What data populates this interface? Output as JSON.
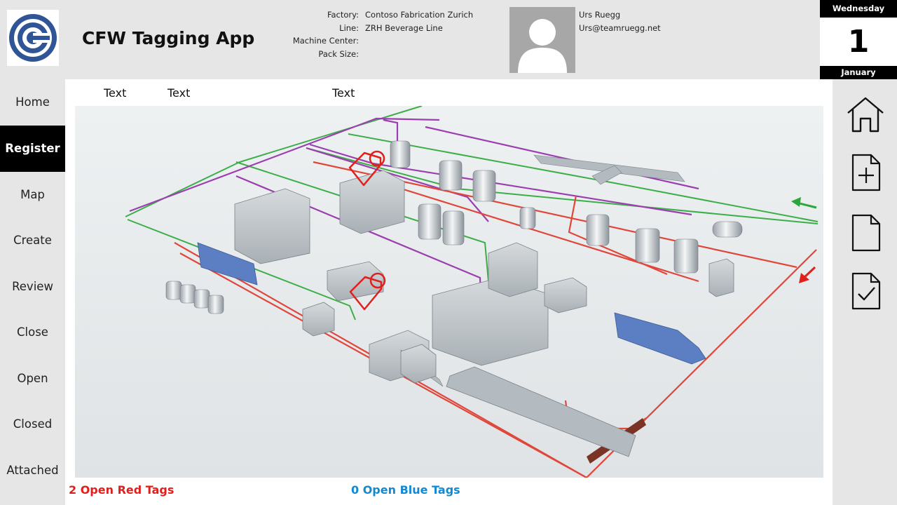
{
  "app": {
    "title": "CFW Tagging App"
  },
  "info": {
    "labels": [
      "Factory:",
      "Line:",
      "Machine Center:",
      "Pack Size:"
    ],
    "values": [
      "Contoso Fabrication Zurich",
      "ZRH Beverage Line",
      "",
      ""
    ]
  },
  "user": {
    "name": "Urs Ruegg",
    "email": "Urs@teamruegg.net"
  },
  "calendar": {
    "weekday": "Wednesday",
    "day": "1",
    "month": "January"
  },
  "nav": {
    "items": [
      {
        "label": "Home",
        "active": false
      },
      {
        "label": "Register",
        "active": true
      },
      {
        "label": "Map",
        "active": false
      },
      {
        "label": "Create",
        "active": false
      },
      {
        "label": "Review",
        "active": false
      },
      {
        "label": "Close",
        "active": false
      },
      {
        "label": "Open",
        "active": false
      },
      {
        "label": "Closed",
        "active": false
      },
      {
        "label": "Attached",
        "active": false
      }
    ]
  },
  "main": {
    "column_headers": [
      "Text",
      "Text",
      "Text"
    ],
    "red_tags_label": "2 Open Red Tags",
    "blue_tags_label": "0 Open Blue Tags"
  },
  "toolbar": {
    "icons": [
      "home-icon",
      "new-document-icon",
      "document-icon",
      "checked-document-icon"
    ]
  },
  "colors": {
    "active_nav_bg": "#000000",
    "red_tag": "#e0201c",
    "blue_tag": "#1289d0",
    "logo_blue": "#2f5597",
    "pipe_purple": "#9b3fb0",
    "pipe_green": "#3cae48",
    "pipe_red": "#e0463a"
  }
}
